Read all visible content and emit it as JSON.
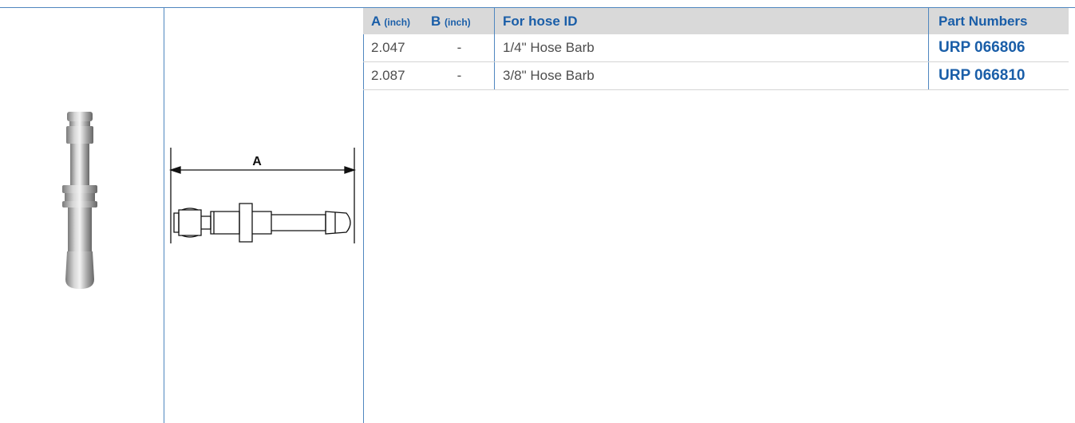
{
  "diagram": {
    "dimension_label": "A"
  },
  "table": {
    "headers": [
      {
        "main": "A",
        "unit": "(inch)"
      },
      {
        "main": "B",
        "unit": "(inch)"
      },
      {
        "main": "For hose ID",
        "unit": ""
      },
      {
        "main": "Part Numbers",
        "unit": ""
      }
    ],
    "rows": [
      {
        "a": "2.047",
        "b": "-",
        "hose": "1/4\" Hose Barb",
        "part": "URP 066806"
      },
      {
        "a": "2.087",
        "b": "-",
        "hose": "3/8\" Hose Barb",
        "part": "URP 066810"
      }
    ]
  },
  "colors": {
    "accent": "#1a5ea8",
    "rule": "#4f86bf",
    "header_bg": "#d9d9d9"
  }
}
